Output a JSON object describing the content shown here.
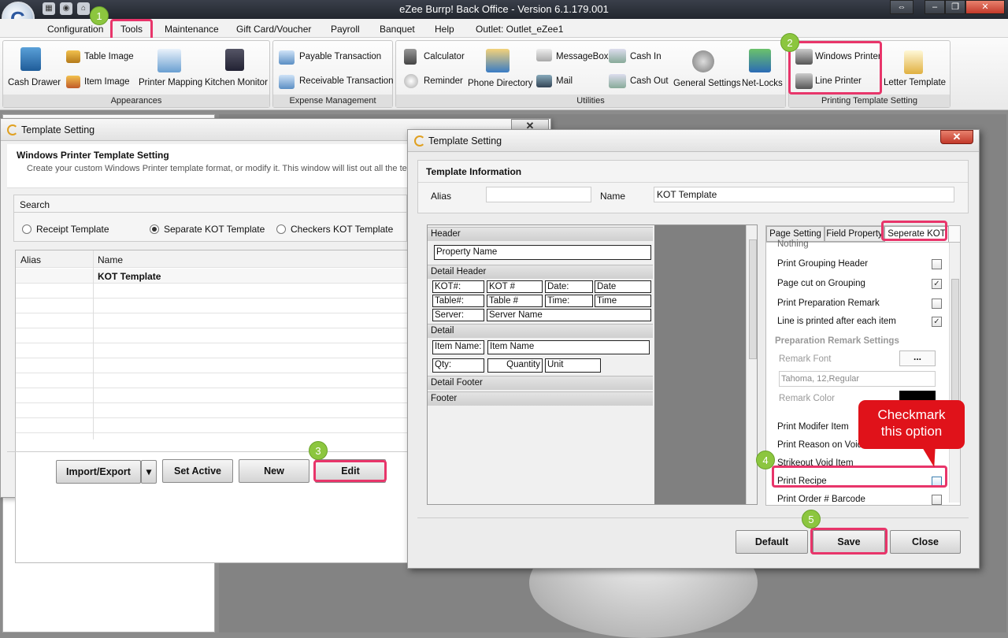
{
  "app": {
    "title": "eZee Burrp! Back Office - Version 6.1.179.001"
  },
  "menu": [
    "Configuration",
    "Tools",
    "Maintenance",
    "Gift Card/Voucher",
    "Payroll",
    "Banquet",
    "Help",
    "Outlet: Outlet_eZee1"
  ],
  "ribbon": {
    "appearances": {
      "title": "Appearances",
      "cash_drawer": "Cash Drawer",
      "table_image": "Table Image",
      "item_image": "Item Image",
      "printer_mapping": "Printer Mapping",
      "kitchen_monitor": "Kitchen Monitor"
    },
    "expense": {
      "title": "Expense Management",
      "payable": "Payable Transaction",
      "receivable": "Receivable Transaction"
    },
    "utilities": {
      "title": "Utilities",
      "calculator": "Calculator",
      "reminder": "Reminder",
      "phone_directory": "Phone Directory",
      "messagebox": "MessageBox",
      "mail": "Mail",
      "cash_in": "Cash In",
      "cash_out": "Cash Out",
      "general_settings": "General Settings",
      "net_locks": "Net-Locks"
    },
    "printing": {
      "title": "Printing Template Setting",
      "windows_printer": "Windows Printer",
      "line_printer": "Line Printer",
      "letter_template": "Letter Template"
    }
  },
  "back_window": {
    "title": "Template Setting",
    "heading": "Windows Printer Template Setting",
    "description": "Create your custom Windows Printer template format, or modify it. This window will list out all the te",
    "search_label": "Search",
    "radios": [
      "Receipt Template",
      "Separate KOT Template",
      "Checkers KOT Template"
    ],
    "selected_radio": "Separate KOT Template",
    "columns": [
      "Alias",
      "Name"
    ],
    "rows": [
      {
        "alias": "",
        "name": "KOT Template"
      }
    ],
    "buttons": {
      "import_export": "Import/Export",
      "set_active": "Set Active",
      "new": "New",
      "edit": "Edit"
    }
  },
  "front_window": {
    "title": "Template Setting",
    "section": "Template Information",
    "alias_label": "Alias",
    "alias_value": "",
    "name_label": "Name",
    "name_value": "KOT Template",
    "preview": {
      "header": "Header",
      "property_name": "Property Name",
      "detail_header": "Detail Header",
      "kot_label": "KOT#:",
      "kot_value": "KOT #",
      "date_label": "Date:",
      "date_value": "Date",
      "table_label": "Table#:",
      "table_value": "Table #",
      "time_label": "Time:",
      "time_value": "Time",
      "server_label": "Server:",
      "server_value": "Server Name",
      "detail": "Detail",
      "item_label": "Item Name:",
      "item_value": "Item Name",
      "qty_label": "Qty:",
      "qty_value": "Quantity",
      "unit_value": "Unit",
      "detail_footer": "Detail Footer",
      "footer": "Footer"
    },
    "tabs": [
      "Page Setting",
      "Field Property",
      "Seperate KOT"
    ],
    "active_tab": "Seperate KOT",
    "props": {
      "nothing": "Nothing",
      "grouping_header": "Print Grouping Header",
      "page_cut": "Page cut on Grouping",
      "prep_remark": "Print Preparation Remark",
      "line_printed": "Line is printed after each item",
      "prep_settings": "Preparation Remark Settings",
      "remark_font": "Remark Font",
      "font_btn": "...",
      "font_value": "Tahoma, 12,Regular",
      "remark_color": "Remark Color",
      "modifier_item": "Print Modifer Item",
      "reason_void": "Print Reason on Void It",
      "strikeout": "Strikeout Void Item",
      "print_recipe": "Print Recipe",
      "order_barcode": "Print Order # Barcode"
    },
    "checks": {
      "grouping_header": false,
      "page_cut": true,
      "prep_remark": false,
      "line_printed": true,
      "print_recipe": false,
      "order_barcode": false
    },
    "callout": "Checkmark this option",
    "buttons": {
      "default": "Default",
      "save": "Save",
      "close": "Close"
    }
  },
  "steps": [
    "1",
    "2",
    "3",
    "4",
    "5"
  ],
  "colors": {
    "highlight": "#e8356a",
    "step": "#8cc63f",
    "callout": "#e0121a"
  }
}
